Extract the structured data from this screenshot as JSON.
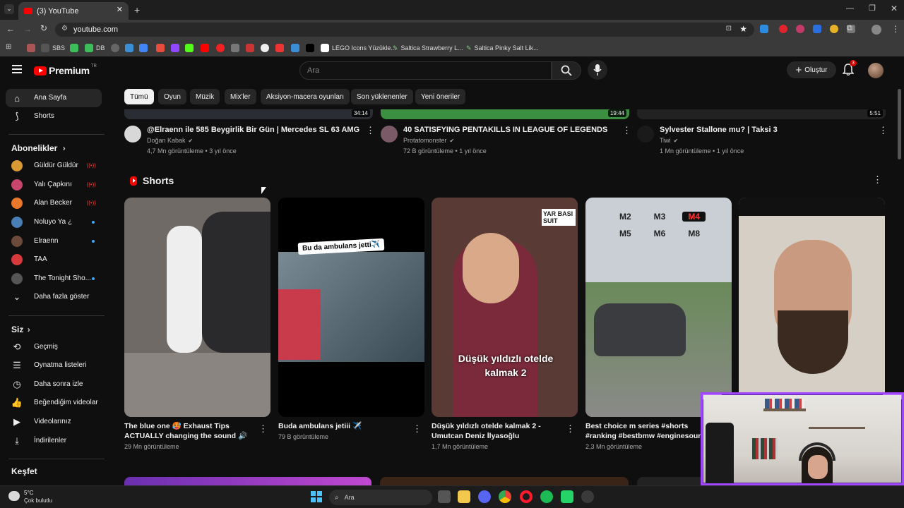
{
  "browser": {
    "tab_title": "(3) YouTube",
    "url": "youtube.com",
    "bookmarks": [
      "SBS",
      "DB",
      "LEGO Icons Yüzükle...",
      "Saltica Strawberry L...",
      "Saltica Pinky Salt Lik..."
    ]
  },
  "header": {
    "logo_text": "Premium",
    "logo_sup": "TR",
    "search_placeholder": "Ara",
    "create_label": "Oluştur",
    "notif_count": "3"
  },
  "sidebar": {
    "main": [
      {
        "label": "Ana Sayfa",
        "icon": "home-icon"
      },
      {
        "label": "Shorts",
        "icon": "shorts-icon"
      }
    ],
    "subs_title": "Abonelikler",
    "subs": [
      {
        "label": "Güldür Güldür",
        "color": "#d99a33",
        "status": "live"
      },
      {
        "label": "Yalı Çapkını",
        "color": "#c7466e",
        "status": "live"
      },
      {
        "label": "Alan Becker",
        "color": "#e8762b",
        "status": "live"
      },
      {
        "label": "Noluyo Ya ¿",
        "color": "#4a7fb5",
        "status": "dot"
      },
      {
        "label": "Elraenn",
        "color": "#6c4a3c",
        "status": "dot"
      },
      {
        "label": "TAA",
        "color": "#d63a3a",
        "status": ""
      },
      {
        "label": "The Tonight Sho...",
        "color": "#555555",
        "status": "dot"
      }
    ],
    "more_label": "Daha fazla göster",
    "you_title": "Siz",
    "you": [
      {
        "label": "Geçmiş",
        "icon": "history-icon",
        "glyph": "⟲"
      },
      {
        "label": "Oynatma listeleri",
        "icon": "playlists-icon",
        "glyph": "☰"
      },
      {
        "label": "Daha sonra izle",
        "icon": "clock-icon",
        "glyph": "◷"
      },
      {
        "label": "Beğendiğim videolar",
        "icon": "thumbs-up-icon",
        "glyph": "👍"
      },
      {
        "label": "Videolarınız",
        "icon": "your-videos-icon",
        "glyph": "▶"
      },
      {
        "label": "İndirilenler",
        "icon": "download-icon",
        "glyph": "⤓"
      }
    ],
    "explore_title": "Keşfet"
  },
  "chips": [
    "Tümü",
    "Oyun",
    "Müzik",
    "Mix'ler",
    "Aksiyon-macera oyunları",
    "Son yüklenenler",
    "Yeni öneriler"
  ],
  "videos": [
    {
      "title": "@Elraenn  ile 585 Beygirlik Bir Gün | Mercedes SL 63 AMG",
      "channel": "Doğan Kabak",
      "meta": "4,7 Mn görüntüleme • 3 yıl önce",
      "duration": "34:14",
      "avatar_color": "#d8d8d8",
      "thumb_color": "#2a2d33"
    },
    {
      "title": "40 SATISFYING PENTAKILLS IN LEAGUE OF LEGENDS",
      "channel": "Protatomonster",
      "meta": "72 B görüntüleme • 1 yıl önce",
      "duration": "19:44",
      "avatar_color": "#7a5a66",
      "thumb_color": "#3b8f40"
    },
    {
      "title": "Sylvester Stallone mu? | Taksi 3",
      "channel": "Tiwi",
      "meta": "1 Mn görüntüleme • 1 yıl önce",
      "duration": "5:51",
      "avatar_color": "#1a1a1a",
      "thumb_color": "#222222"
    }
  ],
  "shorts_title": "Shorts",
  "shorts": [
    {
      "title": "The blue one 🥵 Exhaust Tips ACTUALLY changing the sound 🔊",
      "views": "29 Mn görüntüleme",
      "bg": "#6f6a66",
      "caption": ""
    },
    {
      "title": "Buda ambulans jetiii ✈️",
      "views": "79 B görüntüleme",
      "bg": "#000000",
      "caption": "Bu da ambulans jetti✈️"
    },
    {
      "title": "Düşük yıldızlı otelde kalmak 2 - Umutcan Deniz İlyasoğlu",
      "views": "1,7 Mn görüntüleme",
      "bg": "#5a3a34",
      "caption": "Düşük yıldızlı otelde kalmak 2",
      "sign": "YAR BASI SUIT"
    },
    {
      "title": "Best choice m series #shorts #ranking #bestbmw #enginesound",
      "views": "2,3 Mn görüntüleme",
      "bg": "#c9cfd4",
      "caption": "",
      "badges": [
        "M2",
        "M3",
        "M4",
        "M5",
        "M6",
        "M8"
      ]
    },
    {
      "title": "",
      "views": "",
      "bg": "#d6cfc5",
      "caption": ""
    }
  ],
  "taskbar": {
    "weather_temp": "5°C",
    "weather_desc": "Çok bulutlu",
    "search_placeholder": "Ara"
  },
  "colors": {
    "accent_red": "#ff0000",
    "webcam_border": "#a046ff"
  }
}
